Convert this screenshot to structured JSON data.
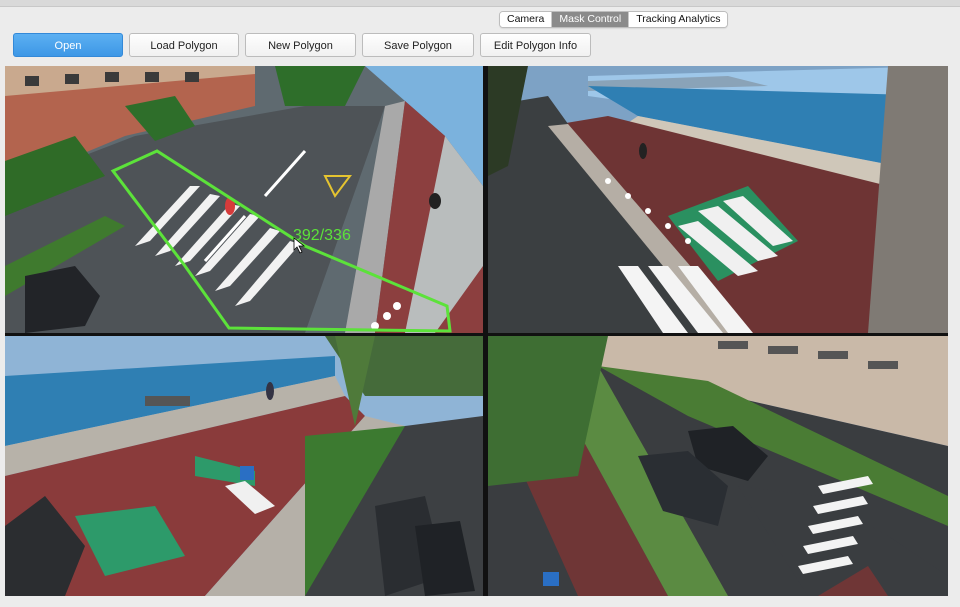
{
  "tabs": [
    {
      "label": "Camera",
      "active": false
    },
    {
      "label": "Mask Control",
      "active": true
    },
    {
      "label": "Tracking Analytics",
      "active": false
    }
  ],
  "toolbar": {
    "open_label": "Open",
    "load_label": "Load Polygon",
    "new_label": "New Polygon",
    "save_label": "Save Polygon",
    "edit_label": "Edit Polygon Info"
  },
  "feeds": {
    "cam1": {
      "coordinate_readout": "392/336",
      "mask_color": "#5ce23a"
    },
    "cam2": {},
    "cam3": {},
    "cam4": {}
  },
  "colors": {
    "accent": "#3d97e6",
    "active_tab": "#8b8b8b",
    "mask": "#5ce23a"
  }
}
